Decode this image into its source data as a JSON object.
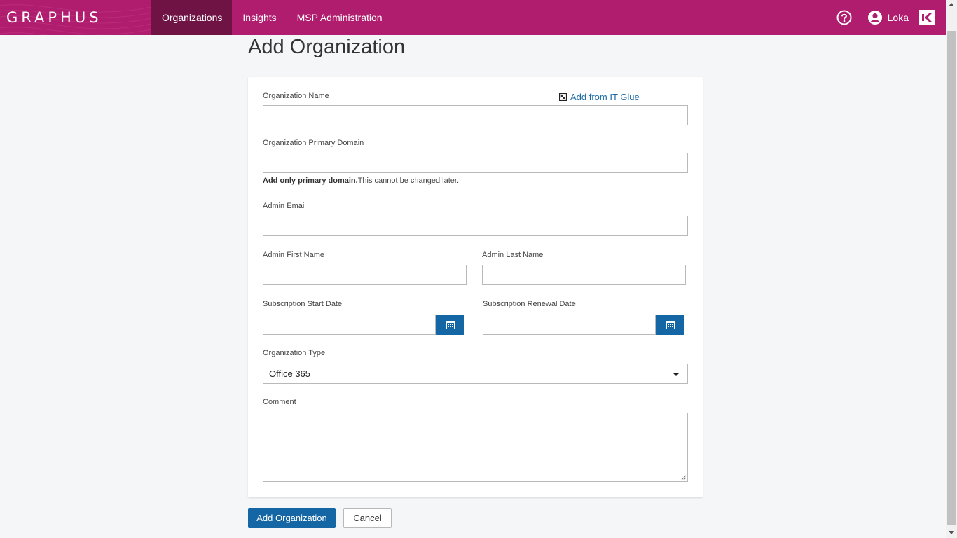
{
  "app": {
    "logo_text": "GRAPHUS",
    "brand_color": "#b01c6e",
    "nav_active_color": "#6e1344",
    "accent_color": "#1466a4"
  },
  "nav": {
    "items": [
      {
        "label": "Organizations",
        "active": true
      },
      {
        "label": "Insights",
        "active": false
      },
      {
        "label": "MSP Administration",
        "active": false
      }
    ],
    "user_name": "Loka",
    "help_icon": "question-circle-icon",
    "user_icon": "user-circle-icon",
    "brand_icon": "kaseya-logo-icon"
  },
  "page": {
    "title": "Add Organization"
  },
  "form": {
    "org_name_label": "Organization Name",
    "it_glue_link": "Add from IT Glue",
    "org_name_value": "",
    "primary_domain_label": "Organization Primary Domain",
    "primary_domain_value": "",
    "primary_domain_hint_bold": "Add only primary domain.",
    "primary_domain_hint": "This cannot be changed later.",
    "admin_email_label": "Admin Email",
    "admin_email_value": "",
    "admin_first_name_label": "Admin First Name",
    "admin_first_name_value": "",
    "admin_last_name_label": "Admin Last Name",
    "admin_last_name_value": "",
    "sub_start_label": "Subscription Start Date",
    "sub_start_value": "",
    "sub_renewal_label": "Subscription Renewal Date",
    "sub_renewal_value": "",
    "org_type_label": "Organization Type",
    "org_type_value": "Office 365",
    "comment_label": "Comment",
    "comment_value": ""
  },
  "actions": {
    "submit_label": "Add Organization",
    "cancel_label": "Cancel"
  }
}
